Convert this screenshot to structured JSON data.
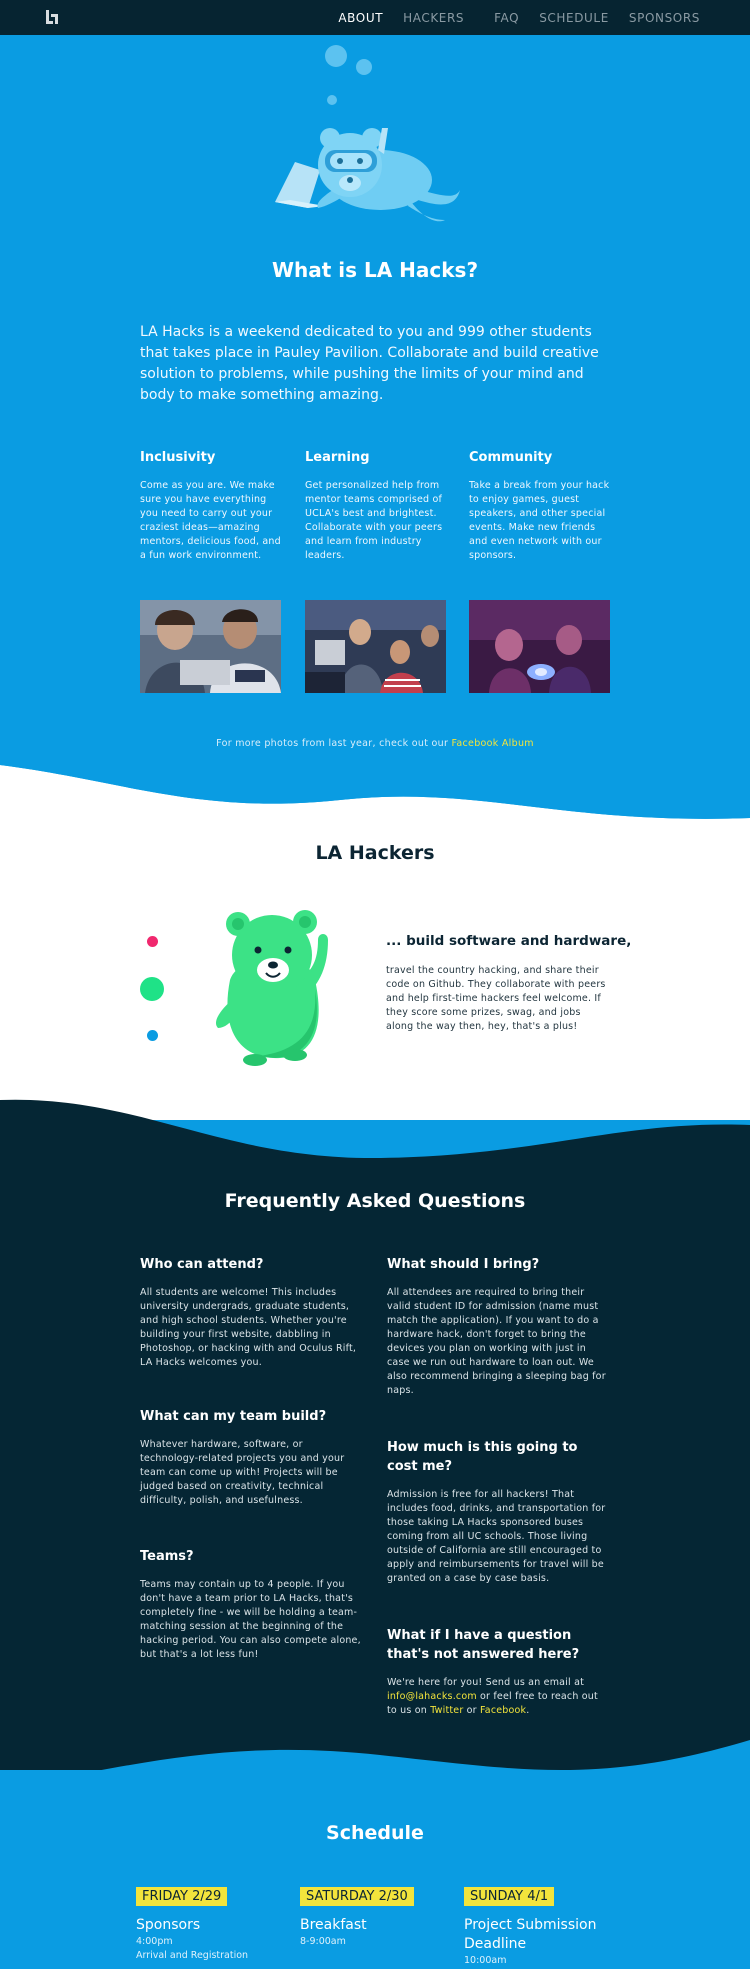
{
  "nav": {
    "items": [
      {
        "label": "ABOUT",
        "active": true
      },
      {
        "label": "HACKERS",
        "active": false
      },
      {
        "label": "FAQ",
        "active": false
      },
      {
        "label": "SCHEDULE",
        "active": false
      },
      {
        "label": "SPONSORS",
        "active": false
      }
    ]
  },
  "about": {
    "title": "What is LA Hacks?",
    "intro": "LA Hacks is a weekend dedicated to you and 999 other students that takes place in Pauley Pavilion. Collaborate and build creative solution to problems, while pushing the limits of your mind and body to make something amazing.",
    "columns": [
      {
        "title": "Inclusivity",
        "text": "Come as you are. We make sure you have everything you need to carry out your craziest ideas—amazing mentors, delicious food, and a fun work environment."
      },
      {
        "title": "Learning",
        "text": "Get personalized help from mentor teams comprised of UCLA's best and brightest. Collaborate with your peers and learn from industry leaders."
      },
      {
        "title": "Community",
        "text": "Take a break from your hack to enjoy games, guest speakers, and other special events. Make new friends and even network with our sponsors."
      }
    ],
    "more_text": "For more photos from last year, check out our ",
    "more_link": "Facebook Album"
  },
  "hackers": {
    "title": "LA Hackers",
    "heading": "... build software and hardware,",
    "text": "travel the country hacking, and share their code on Github. They collaborate with peers and help first-time hackers feel welcome. If they score some prizes, swag, and jobs along the way then, hey, that's a plus!"
  },
  "faq": {
    "title": "Frequently Asked Questions",
    "q1": {
      "q": "Who can attend?",
      "a": "All students are welcome! This includes university undergrads, graduate students, and high school students. Whether you're building your first website, dabbling in Photoshop, or hacking with and Oculus Rift, LA Hacks welcomes you."
    },
    "q2": {
      "q": "What can my team build?",
      "a": "Whatever hardware, software, or technology-related projects you and your team can come up with! Projects will be judged based on creativity, technical difficulty, polish, and usefulness."
    },
    "q3": {
      "q": "Teams?",
      "a": "Teams may contain up to 4 people. If you don't have a team prior to LA Hacks, that's completely fine - we will be holding a team-matching session at the beginning of the hacking period. You can also compete alone, but that's a lot less fun!"
    },
    "q4": {
      "q": "What should I bring?",
      "a": "All attendees are required to bring their valid student ID for admission (name must match the application). If you want to do a hardware hack, don't forget to bring the devices you plan on working with just in case we run out hardware to loan out. We also recommend bringing a sleeping bag for naps."
    },
    "q5": {
      "q": "How much is this going to cost me?",
      "a": "Admission is free for all hackers! That includes food, drinks, and transportation for those taking LA Hacks sponsored buses coming from all UC schools. Those living outside of California are still encouraged to apply and reimbursements for travel will be granted on a case by case basis."
    },
    "q6": {
      "q": "What if I have a question that's not answered here?",
      "a_pre": "We're here for you! Send us an email at ",
      "email": "info@lahacks.com",
      "a_mid": " or feel free to reach out to us on ",
      "twitter": "Twitter",
      "a_or": " or ",
      "facebook": "Facebook",
      "a_end": "."
    }
  },
  "schedule": {
    "title": "Schedule",
    "days": [
      {
        "label": "FRIDAY 2/29",
        "event": "Sponsors",
        "time": "4:00pm",
        "sub": "Arrival and Registration"
      },
      {
        "label": "SATURDAY 2/30",
        "event": "Breakfast",
        "time": "8-9:00am",
        "sub": ""
      },
      {
        "label": "SUNDAY 4/1",
        "event": "Project Submission Deadline",
        "time": "10:00am",
        "sub": ""
      }
    ]
  },
  "colors": {
    "primary_blue": "#0a9ce2",
    "navy": "#062431",
    "faq_bg": "#052634",
    "accent_yellow": "#f3e43c",
    "bear_green": "#3ce286"
  }
}
